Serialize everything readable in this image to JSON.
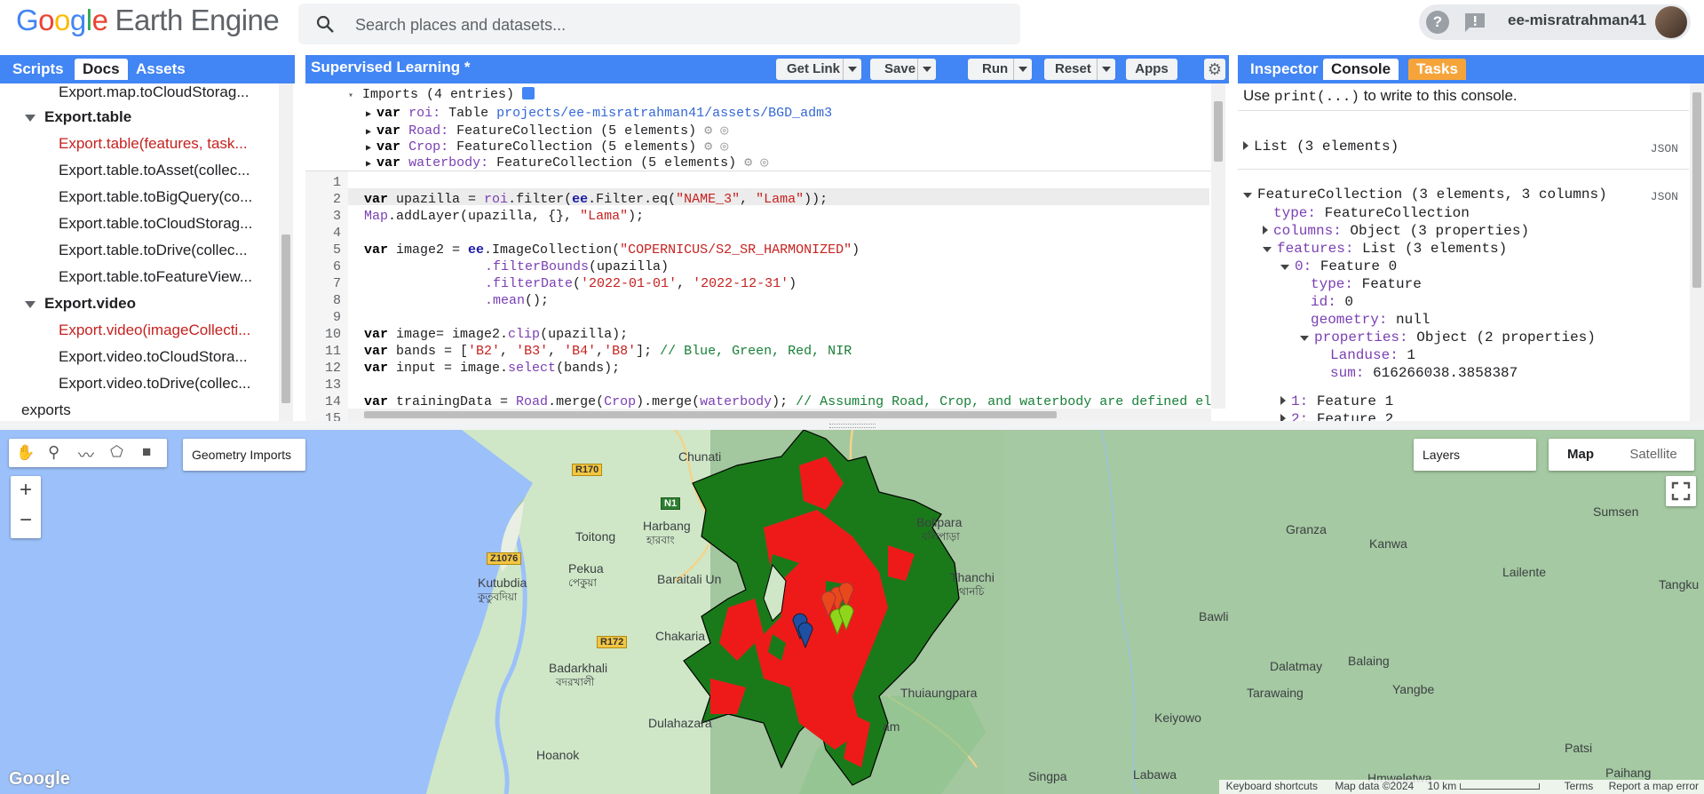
{
  "header": {
    "logo_google": "Google",
    "logo_product": "Earth Engine",
    "search_placeholder": "Search places and datasets...",
    "help_icon": "?",
    "username": "ee-misratrahman41"
  },
  "left_panel": {
    "tabs": [
      "Scripts",
      "Docs",
      "Assets"
    ],
    "active_tab": "Docs",
    "items": [
      {
        "label": "Export.map.toCloudStorag...",
        "style": "normal"
      },
      {
        "label": "Export.table",
        "style": "group"
      },
      {
        "label": "Export.table(features, task...",
        "style": "red"
      },
      {
        "label": "Export.table.toAsset(collec...",
        "style": "normal"
      },
      {
        "label": "Export.table.toBigQuery(co...",
        "style": "normal"
      },
      {
        "label": "Export.table.toCloudStorag...",
        "style": "normal"
      },
      {
        "label": "Export.table.toDrive(collec...",
        "style": "normal"
      },
      {
        "label": "Export.table.toFeatureView...",
        "style": "normal"
      },
      {
        "label": "Export.video",
        "style": "group"
      },
      {
        "label": "Export.video(imageCollecti...",
        "style": "red"
      },
      {
        "label": "Export.video.toCloudStora...",
        "style": "normal"
      },
      {
        "label": "Export.video.toDrive(collec...",
        "style": "normal"
      },
      {
        "label": "exports",
        "style": "root"
      }
    ]
  },
  "editor": {
    "title": "Supervised Learning *",
    "buttons": {
      "get_link": "Get Link",
      "save": "Save",
      "run": "Run",
      "reset": "Reset",
      "apps": "Apps"
    },
    "imports_header": "Imports (4 entries)",
    "imports": [
      {
        "kw": "var",
        "name": "roi:",
        "type": "Table",
        "extra": "projects/ee-misratrahman41/assets/BGD_adm3"
      },
      {
        "kw": "var",
        "name": "Road:",
        "type": "FeatureCollection (5 elements)",
        "extra": ""
      },
      {
        "kw": "var",
        "name": "Crop:",
        "type": "FeatureCollection (5 elements)",
        "extra": ""
      },
      {
        "kw": "var",
        "name": "waterbody:",
        "type": "FeatureCollection (5 elements)",
        "extra": ""
      }
    ],
    "line_numbers": [
      "1",
      "2",
      "3",
      "4",
      "5",
      "6",
      "7",
      "8",
      "9",
      "10",
      "11",
      "12",
      "13",
      "14",
      "15"
    ],
    "code": {
      "l2a": "var",
      "l2b": " upazilla = ",
      "l2c": "roi",
      "l2d": ".filter(",
      "l2e": "ee",
      "l2f": ".Filter.eq(",
      "l2g": "\"NAME_3\"",
      "l2h": ", ",
      "l2i": "\"Lama\"",
      "l2j": "));",
      "l3a": "Map",
      "l3b": ".addLayer(upazilla, {}, ",
      "l3c": "\"Lama\"",
      "l3d": ");",
      "l5a": "var",
      "l5b": " image2 = ",
      "l5c": "ee",
      "l5d": ".ImageCollection(",
      "l5e": "\"COPERNICUS/S2_SR_HARMONIZED\"",
      "l5f": ")",
      "l6a": ".filterBounds",
      "l6b": "(upazilla)",
      "l7a": ".filterDate",
      "l7b": "(",
      "l7c": "'2022-01-01'",
      "l7d": ", ",
      "l7e": "'2022-12-31'",
      "l7f": ")",
      "l8a": ".mean",
      "l8b": "();",
      "l10a": "var",
      "l10b": " image= image2.",
      "l10c": "clip",
      "l10d": "(upazilla);",
      "l11a": "var",
      "l11b": " bands = [",
      "l11c": "'B2'",
      "l11d": ", ",
      "l11e": "'B3'",
      "l11f": ", ",
      "l11g": "'B4'",
      "l11h": ",",
      "l11i": "'B8'",
      "l11j": "]; ",
      "l11k": "// Blue, Green, Red, NIR",
      "l12a": "var",
      "l12b": " input = image.",
      "l12c": "select",
      "l12d": "(bands);",
      "l14a": "var",
      "l14b": " trainingData = ",
      "l14c": "Road",
      "l14d": ".merge(",
      "l14e": "Crop",
      "l14f": ").merge(",
      "l14g": "waterbody",
      "l14h": "); ",
      "l14i": "// Assuming Road, Crop, and waterbody are defined else"
    }
  },
  "right_panel": {
    "tabs": [
      "Inspector",
      "Console",
      "Tasks"
    ],
    "active_tab": "Console",
    "hint_pre": "Use ",
    "hint_code": "print(...)",
    "hint_post": " to write to this console.",
    "json_label": "JSON",
    "list": "List (3 elements)",
    "fc": "FeatureCollection (3 elements, 3 columns)",
    "rows": {
      "type_k": "type:",
      "type_v": "FeatureCollection",
      "columns_k": "columns:",
      "columns_v": "Object (3 properties)",
      "features_k": "features:",
      "features_v": "List (3 elements)",
      "f0_k": "0:",
      "f0_v": "Feature 0",
      "f0type_k": "type:",
      "f0type_v": "Feature",
      "id_k": "id:",
      "id_v": "0",
      "geom_k": "geometry:",
      "geom_v": "null",
      "props_k": "properties:",
      "props_v": "Object (2 properties)",
      "land_k": "Landuse:",
      "land_v": "1",
      "sum_k": "sum:",
      "sum_v": "616266038.3858387",
      "f1_k": "1:",
      "f1_v": "Feature 1",
      "f2_k": "2:",
      "f2_v": "Feature 2"
    }
  },
  "map": {
    "geometry_imports": "Geometry Imports",
    "layers": "Layers",
    "map_btn": "Map",
    "satellite_btn": "Satellite",
    "zoom_in": "+",
    "zoom_out": "−",
    "google_logo": "Google",
    "places": {
      "chunati": "Chunati",
      "harbang": "Harbang",
      "harbang_bn": "হারবাং",
      "toitong": "Toitong",
      "pekua": "Pekua",
      "pekua_bn": "পেকুয়া",
      "baraitali": "Baraitali Un",
      "kutubdia": "Kutubdia",
      "kutubdia_bn": "কুতুবদিয়া",
      "chakaria": "Chakaria",
      "badarkhali": "Badarkhali",
      "badarkhali_bn": "বদরখালী",
      "dulahazara": "Dulahazara",
      "hoanok": "Hoanok",
      "bolipara": "Bolipara",
      "bolipara_bn": "বলিপাড়া",
      "thanchi": "Thanchi",
      "thanchi_bn": "থানচি",
      "thuiaungpara": "Thuiaungpara",
      "singpa": "Singpa",
      "labawa": "Labawa",
      "keiyowo": "Keiyowo",
      "bawli": "Bawli",
      "dalatmay": "Dalatmay",
      "balaing": "Balaing",
      "tarawaing": "Tarawaing",
      "yangbe": "Yangbe",
      "granza": "Granza",
      "kanwa": "Kanwa",
      "lailente": "Lailente",
      "sumsen": "Sumsen",
      "tangku": "Tangku",
      "patsi": "Patsi",
      "paihang": "Paihang",
      "hmweletwa": "Hmweletwa",
      "lama_partial": "am"
    },
    "roads": {
      "r170": "R170",
      "n1": "N1",
      "z1076": "Z1076",
      "r172": "R172"
    },
    "attribution": {
      "shortcuts": "Keyboard shortcuts",
      "data": "Map data ©2024",
      "scale": "10 km",
      "terms": "Terms",
      "report": "Report a map error"
    }
  },
  "colors": {
    "accent": "#4285f4",
    "tasks_tab": "#f6a43a",
    "crop_layer": "#ea1c1c",
    "green_layer": "#1b7d1b"
  }
}
